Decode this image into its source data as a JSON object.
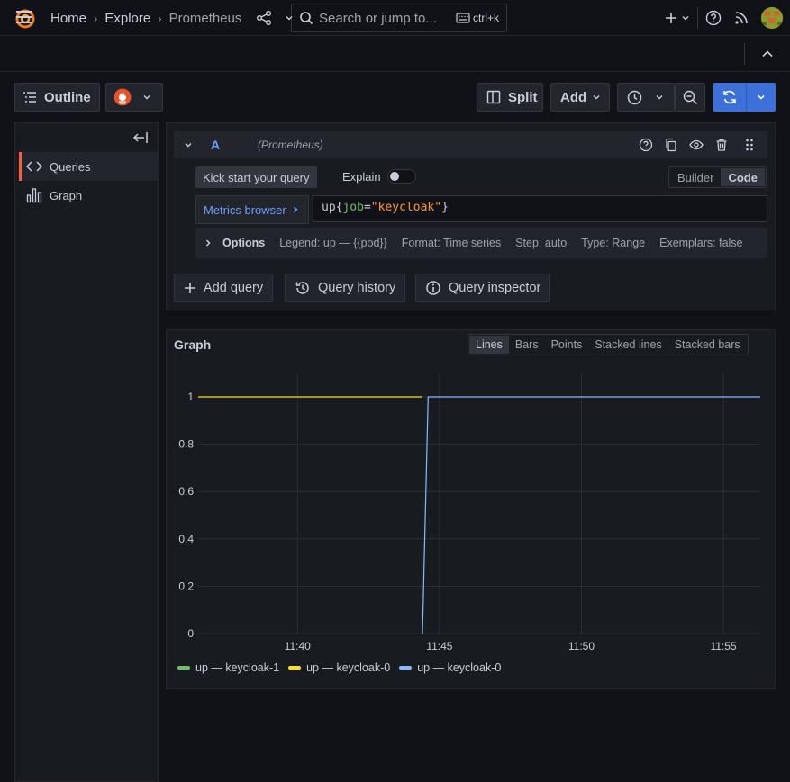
{
  "topbar": {
    "search_placeholder": "Search or jump to...",
    "search_shortcut": "ctrl+k"
  },
  "breadcrumb": {
    "items": [
      "Home",
      "Explore",
      "Prometheus"
    ]
  },
  "toolbar": {
    "outline_label": "Outline",
    "split_label": "Split",
    "add_label": "Add"
  },
  "outline": {
    "items": [
      {
        "label": "Queries",
        "icon": "code-icon",
        "active": true
      },
      {
        "label": "Graph",
        "icon": "bar-chart-icon",
        "active": false
      }
    ]
  },
  "query": {
    "ref_id": "A",
    "datasource": "(Prometheus)",
    "kick_start_label": "Kick start your query",
    "explain_label": "Explain",
    "explain_on": false,
    "mode_builder": "Builder",
    "mode_code": "Code",
    "active_mode": "Code",
    "metrics_browser_label": "Metrics browser",
    "expr": {
      "fn": "up",
      "open": "{",
      "label": "job",
      "eq": "=",
      "value": "\"keycloak\"",
      "close": "}"
    },
    "options": {
      "title": "Options",
      "legend": "Legend: up — {{pod}}",
      "format": "Format: Time series",
      "step": "Step: auto",
      "type": "Type: Range",
      "exemplars": "Exemplars: false"
    },
    "add_query_label": "Add query",
    "query_history_label": "Query history",
    "query_inspector_label": "Query inspector"
  },
  "graph": {
    "title": "Graph",
    "types": [
      "Lines",
      "Bars",
      "Points",
      "Stacked lines",
      "Stacked bars"
    ],
    "active_type": "Lines",
    "legend": [
      {
        "label": "up — keycloak-1",
        "color": "#73bf69"
      },
      {
        "label": "up — keycloak-0",
        "color": "#fade2a"
      },
      {
        "label": "up — keycloak-0",
        "color": "#8ab8ff"
      }
    ]
  },
  "chart_data": {
    "type": "line",
    "title": "Graph",
    "x_ticks": [
      "11:40",
      "11:45",
      "11:50",
      "11:55"
    ],
    "y_ticks": [
      "0",
      "0.2",
      "0.4",
      "0.6",
      "0.8",
      "1"
    ],
    "ylim": [
      0,
      1
    ],
    "x_domain_minutes": [
      36.5,
      56.3
    ],
    "grid": true,
    "legend_placement": "bottom-left",
    "series": [
      {
        "name": "up — keycloak-1",
        "color": "#73bf69",
        "points": []
      },
      {
        "name": "up — keycloak-0",
        "color": "#fade2a",
        "points": [
          [
            36.5,
            1
          ],
          [
            44.4,
            1
          ]
        ]
      },
      {
        "name": "up — keycloak-0",
        "color": "#8ab8ff",
        "points": [
          [
            44.4,
            0
          ],
          [
            44.6,
            1
          ],
          [
            56.3,
            1
          ]
        ]
      }
    ]
  }
}
